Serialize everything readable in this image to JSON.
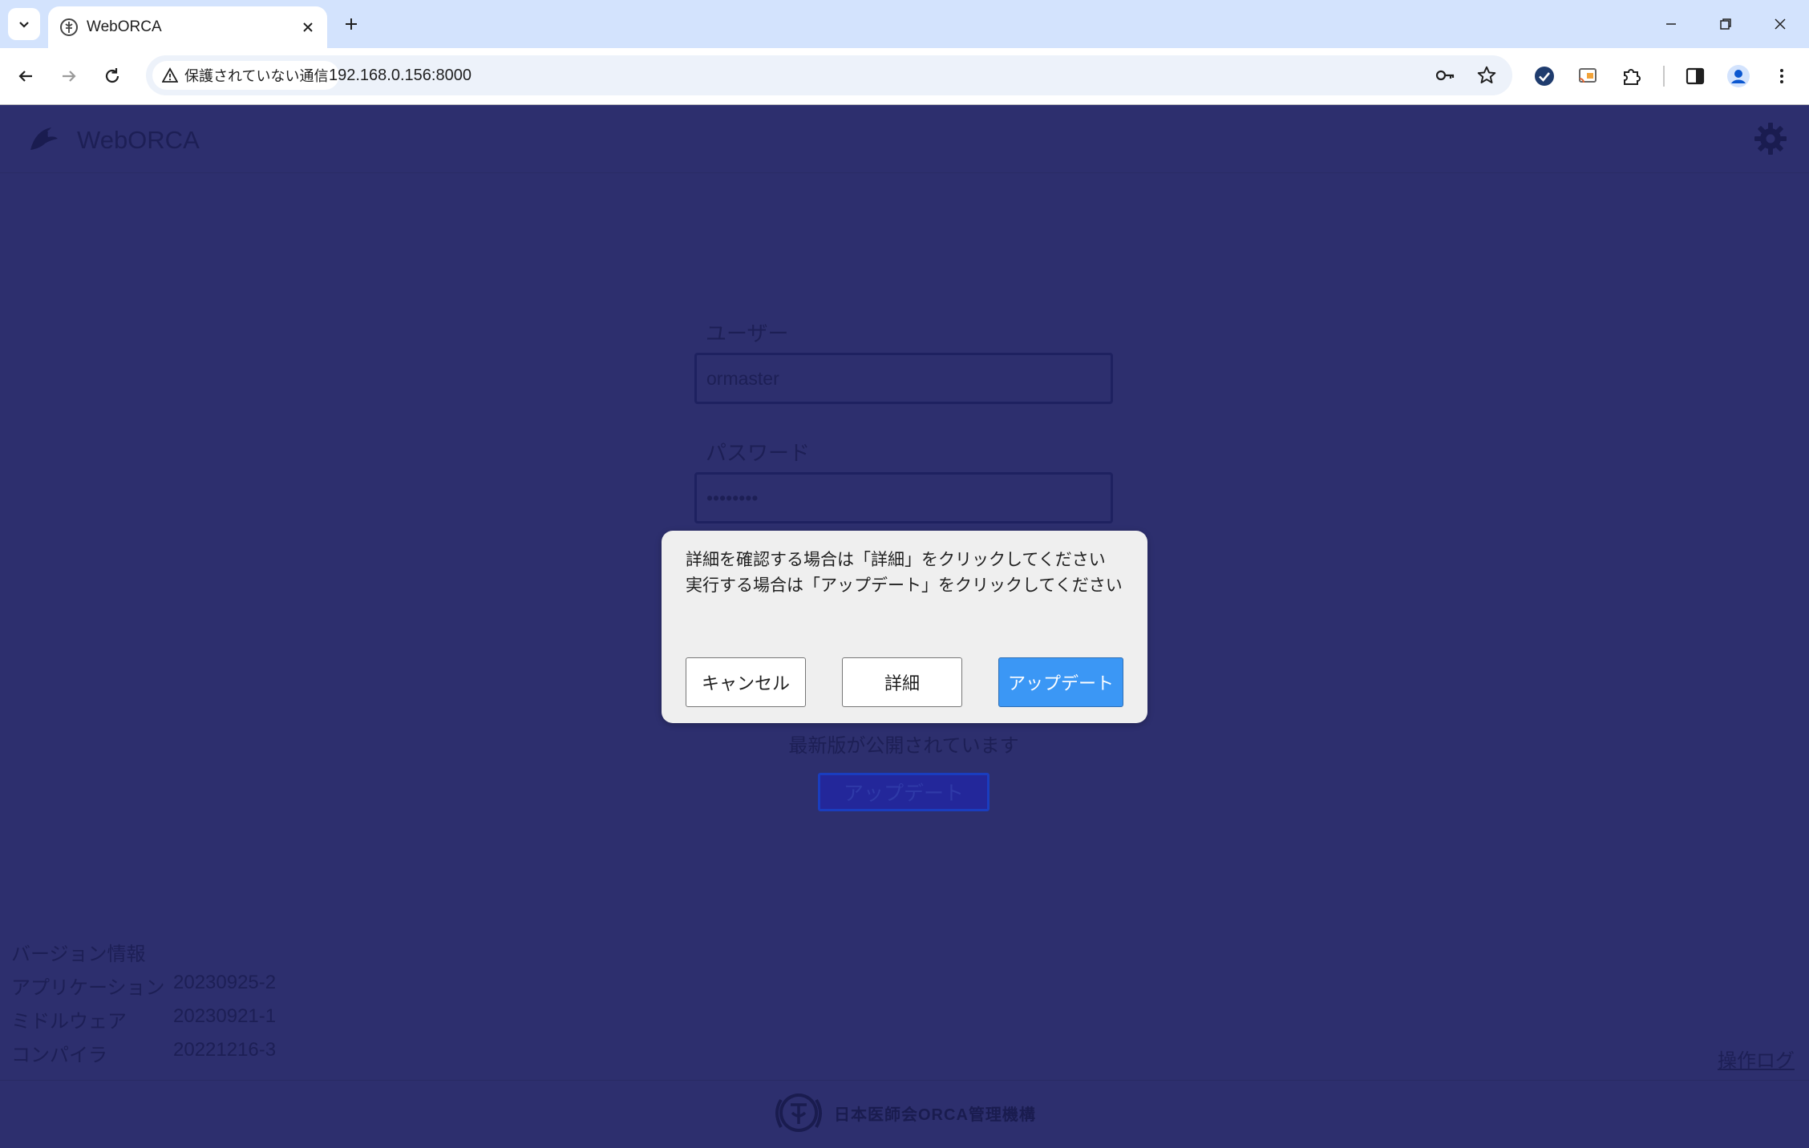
{
  "browser": {
    "tab_title": "WebORCA",
    "security_label": "保護されていない通信",
    "url": "192.168.0.156:8000"
  },
  "app": {
    "title": "WebORCA"
  },
  "login": {
    "user_label": "ユーザー",
    "user_value": "ormaster",
    "password_label": "パスワード",
    "password_value": "••••••••"
  },
  "update_notice": {
    "text": "最新版が公開されています",
    "button_label": "アップデート"
  },
  "dialog": {
    "line1": "詳細を確認する場合は「詳細」をクリックしてください",
    "line2": "実行する場合は「アップデート」をクリックしてください",
    "cancel_label": "キャンセル",
    "detail_label": "詳細",
    "update_label": "アップデート"
  },
  "version": {
    "title": "バージョン情報",
    "rows": [
      {
        "label": "アプリケーション",
        "value": "20230925-2"
      },
      {
        "label": "ミドルウェア",
        "value": "20230921-1"
      },
      {
        "label": "コンパイラ",
        "value": "20221216-3"
      }
    ]
  },
  "footer": {
    "oplog_label": "操作ログ",
    "org_name": "日本医師会ORCA管理機構"
  },
  "colors": {
    "page_bg": "#2d2f6e",
    "dialog_bg": "#efefef",
    "primary_button": "#3b97f5",
    "chrome_tabbar": "#d3e3fd"
  },
  "icons": {
    "tab_list": "chevron-down-icon",
    "favicon": "orca-favicon-icon",
    "close": "close-icon",
    "new_tab": "plus-icon",
    "back": "arrow-left-icon",
    "forward": "arrow-right-icon",
    "reload": "reload-icon",
    "warning": "warning-triangle-icon",
    "password_key": "key-icon",
    "bookmark": "star-icon",
    "settings": "gear-icon"
  }
}
